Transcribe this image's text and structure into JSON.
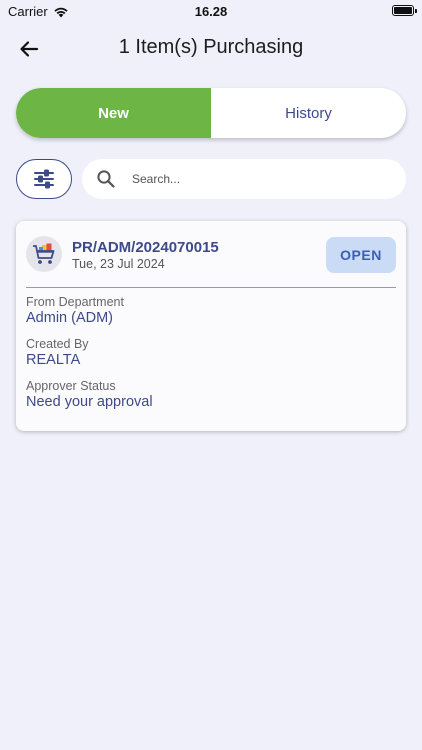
{
  "status_bar": {
    "carrier": "Carrier",
    "time": "16.28"
  },
  "header": {
    "title": "1 Item(s) Purchasing",
    "back_icon": "arrow-left-icon"
  },
  "tabs": [
    {
      "label": "New",
      "active": true
    },
    {
      "label": "History",
      "active": false
    }
  ],
  "filter": {
    "icon": "sliders-icon"
  },
  "search": {
    "placeholder": "Search...",
    "value": ""
  },
  "purchase_card": {
    "pr_number": "PR/ADM/2024070015",
    "date": "Tue, 23 Jul 2024",
    "status": "OPEN",
    "icon": "shopping-cart-icon",
    "fields": [
      {
        "label": "From Department",
        "value": "Admin (ADM)"
      },
      {
        "label": "Created By",
        "value": "REALTA"
      },
      {
        "label": "Approver Status",
        "value": "Need your approval"
      }
    ]
  },
  "colors": {
    "background": "#f0f0fb",
    "accent_green": "#6db645",
    "primary_navy": "#3d4a8a",
    "badge_bg": "#c9dbf5",
    "badge_text": "#3b5fb8"
  }
}
